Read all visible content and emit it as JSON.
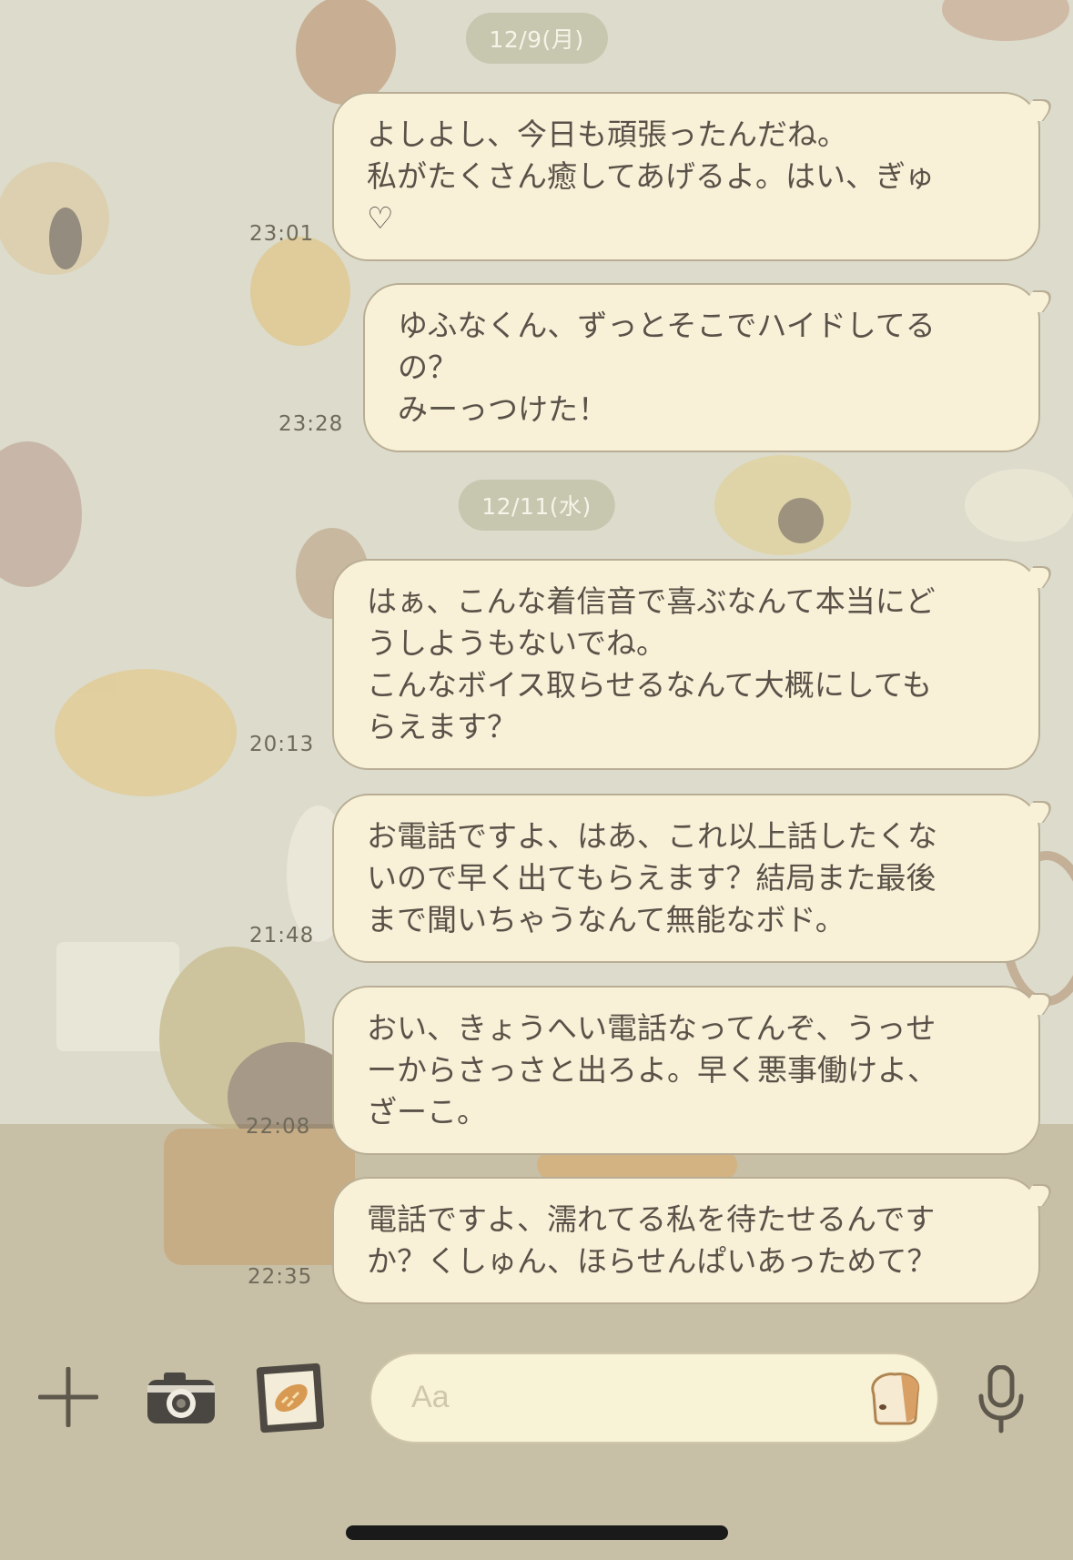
{
  "colors": {
    "bubble_bg": "#f8f1d8",
    "bubble_border": "#b9ae95",
    "text": "#5a5248",
    "date_pill_bg": "#c7c7b0",
    "background": "#dcdbcc"
  },
  "dates": {
    "d1": "12/9(月)",
    "d2": "12/11(水)"
  },
  "messages": [
    {
      "time": "23:01",
      "text": "よしよし、今日も頑張ったんだね。\n私がたくさん癒してあげるよ。はい、ぎゅ\n♡"
    },
    {
      "time": "23:28",
      "text": "ゆふなくん、ずっとそこでハイドしてる\nの？\nみーっつけた！"
    },
    {
      "time": "20:13",
      "text": "はぁ、こんな着信音で喜ぶなんて本当にど\nうしようもないでね。\nこんなボイス取らせるなんて大概にしても\nらえます？"
    },
    {
      "time": "21:48",
      "text": "お電話ですよ、はあ、これ以上話したくな\nいので早く出てもらえます？結局また最後\nまで聞いちゃうなんて無能なボド。"
    },
    {
      "time": "22:08",
      "text": "おい、きょうへい電話なってんぞ、うっせ\nーからさっさと出ろよ。早く悪事働けよ、\nざーこ。"
    },
    {
      "time": "22:35",
      "text": "電話ですよ、濡れてる私を待たせるんです\nか？くしゅん、ほらせんぱいあっためて？"
    }
  ],
  "toolbar": {
    "input_placeholder": "Aa",
    "icons": [
      "plus-icon",
      "camera-icon",
      "photo-icon",
      "bread-sticker-icon",
      "microphone-icon"
    ]
  }
}
